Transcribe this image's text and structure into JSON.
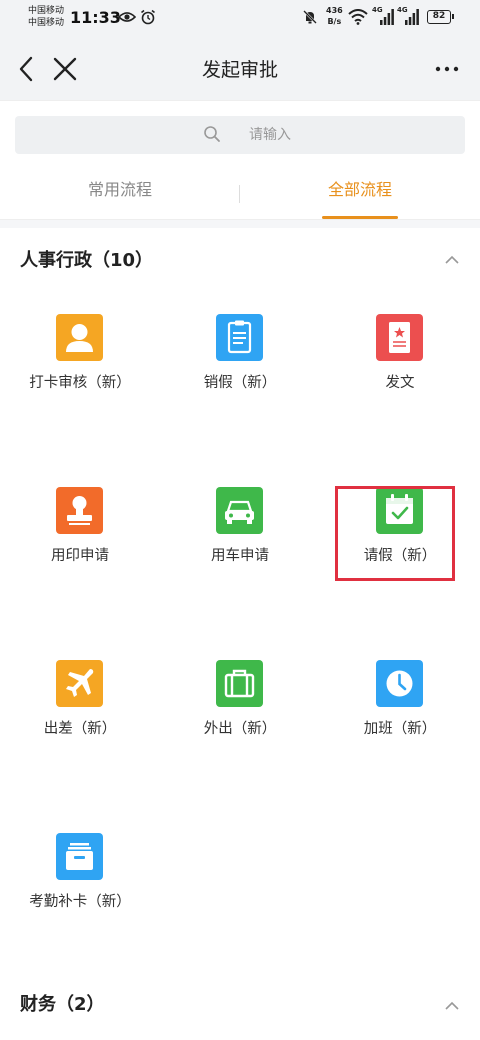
{
  "statusbar": {
    "carrier1": "中国移动",
    "carrier2": "中国移动",
    "time": "11:33",
    "netspeed_value": "436",
    "netspeed_unit": "B/s",
    "signal1_label": "4G",
    "signal2_label": "4G",
    "battery": "82"
  },
  "navbar": {
    "title": "发起审批"
  },
  "search": {
    "placeholder": "请输入"
  },
  "tabs": [
    {
      "label": "常用流程",
      "active": false
    },
    {
      "label": "全部流程",
      "active": true
    }
  ],
  "colors": {
    "accent": "#e8901c",
    "highlight": "#e03040"
  },
  "sections": [
    {
      "title": "人事行政（10）",
      "items": [
        {
          "label": "打卡审核（新）",
          "icon": "person-icon",
          "color": "#f5a623"
        },
        {
          "label": "销假（新）",
          "icon": "clipboard-icon",
          "color": "#2fa4f3"
        },
        {
          "label": "发文",
          "icon": "document-star-icon",
          "color": "#ec4f4f"
        },
        {
          "label": "用印申请",
          "icon": "stamp-icon",
          "color": "#f26b2a"
        },
        {
          "label": "用车申请",
          "icon": "car-icon",
          "color": "#3fb84a"
        },
        {
          "label": "请假（新）",
          "icon": "calendar-check-icon",
          "color": "#3fb84a"
        },
        {
          "label": "出差（新）",
          "icon": "airplane-icon",
          "color": "#f5a623"
        },
        {
          "label": "外出（新）",
          "icon": "briefcase-icon",
          "color": "#3fb84a"
        },
        {
          "label": "加班（新）",
          "icon": "clock-icon",
          "color": "#2fa4f3"
        },
        {
          "label": "考勤补卡（新）",
          "icon": "card-stack-icon",
          "color": "#2fa4f3"
        }
      ]
    },
    {
      "title": "财务（2）",
      "items": []
    }
  ]
}
